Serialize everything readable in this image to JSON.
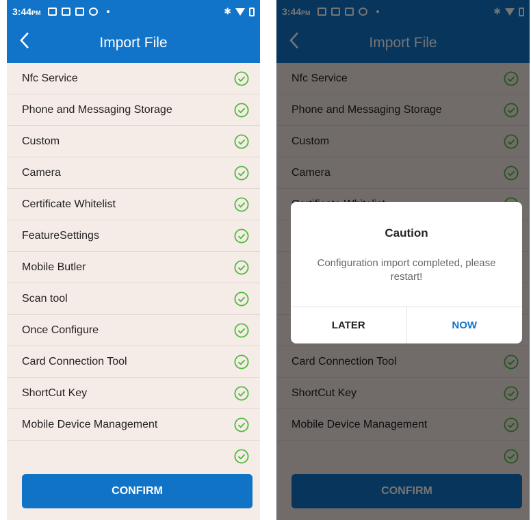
{
  "status": {
    "time": "3:44",
    "ampm": "PM",
    "bluetooth": "✱"
  },
  "header": {
    "title": "Import File",
    "back_icon": "chevron-left-icon"
  },
  "items": [
    {
      "label": "Nfc Service",
      "status": "checked"
    },
    {
      "label": "Phone and Messaging Storage",
      "status": "checked"
    },
    {
      "label": "Custom",
      "status": "checked"
    },
    {
      "label": "Camera",
      "status": "checked"
    },
    {
      "label": "Certificate Whitelist",
      "status": "checked"
    },
    {
      "label": "FeatureSettings",
      "status": "checked"
    },
    {
      "label": "Mobile Butler",
      "status": "checked"
    },
    {
      "label": "Scan tool",
      "status": "checked"
    },
    {
      "label": "Once Configure",
      "status": "checked"
    },
    {
      "label": "Card Connection Tool",
      "status": "checked"
    },
    {
      "label": "ShortCut Key",
      "status": "checked"
    },
    {
      "label": "Mobile Device Management",
      "status": "checked"
    }
  ],
  "confirm_label": "CONFIRM",
  "dialog": {
    "title": "Caution",
    "message": "Configuration import completed, please restart!",
    "later_label": "LATER",
    "now_label": "NOW"
  },
  "colors": {
    "primary": "#1174c8",
    "check": "#4cbb3a",
    "list_bg": "#f6ece7"
  }
}
